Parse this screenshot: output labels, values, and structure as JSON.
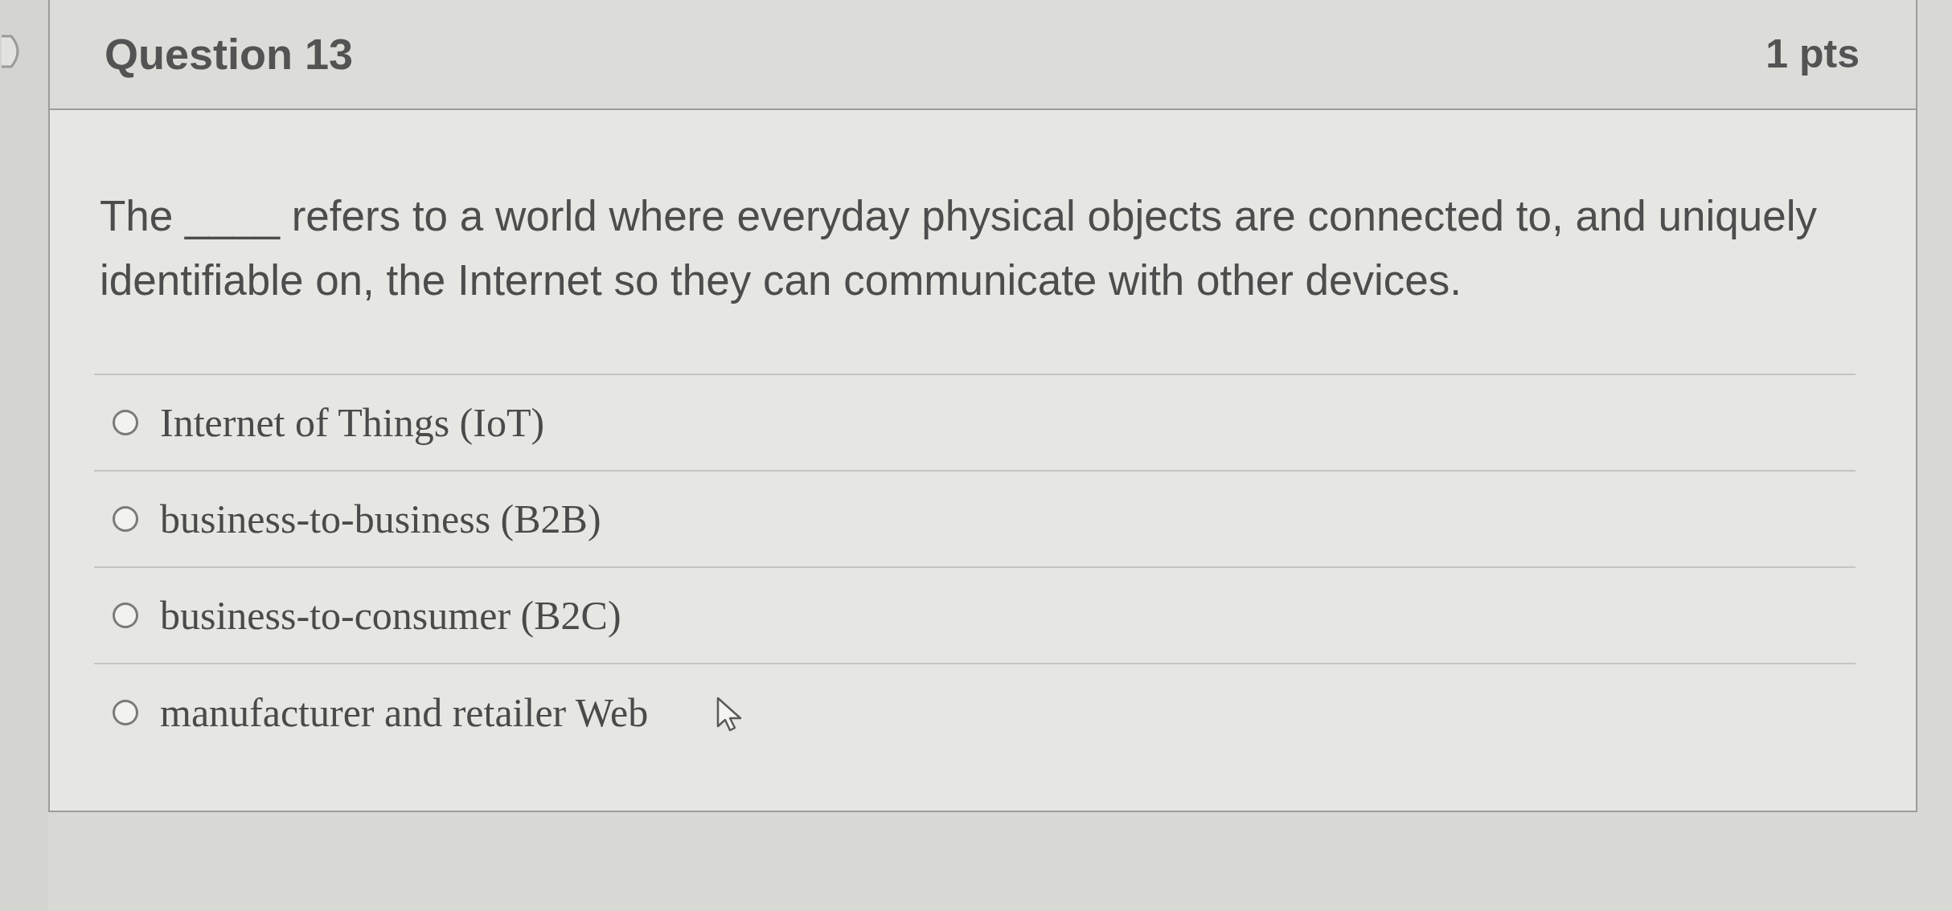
{
  "question": {
    "title": "Question 13",
    "points": "1 pts",
    "text": "The ____ refers to a world where everyday physical objects are connected to, and uniquely identifiable on, the Internet so they can communicate with other devices.",
    "answers": [
      {
        "label": "Internet of Things (IoT)",
        "selected": false
      },
      {
        "label": "business-to-business (B2B)",
        "selected": false
      },
      {
        "label": "business-to-consumer (B2C)",
        "selected": false
      },
      {
        "label": "manufacturer and retailer Web",
        "selected": false
      }
    ]
  }
}
